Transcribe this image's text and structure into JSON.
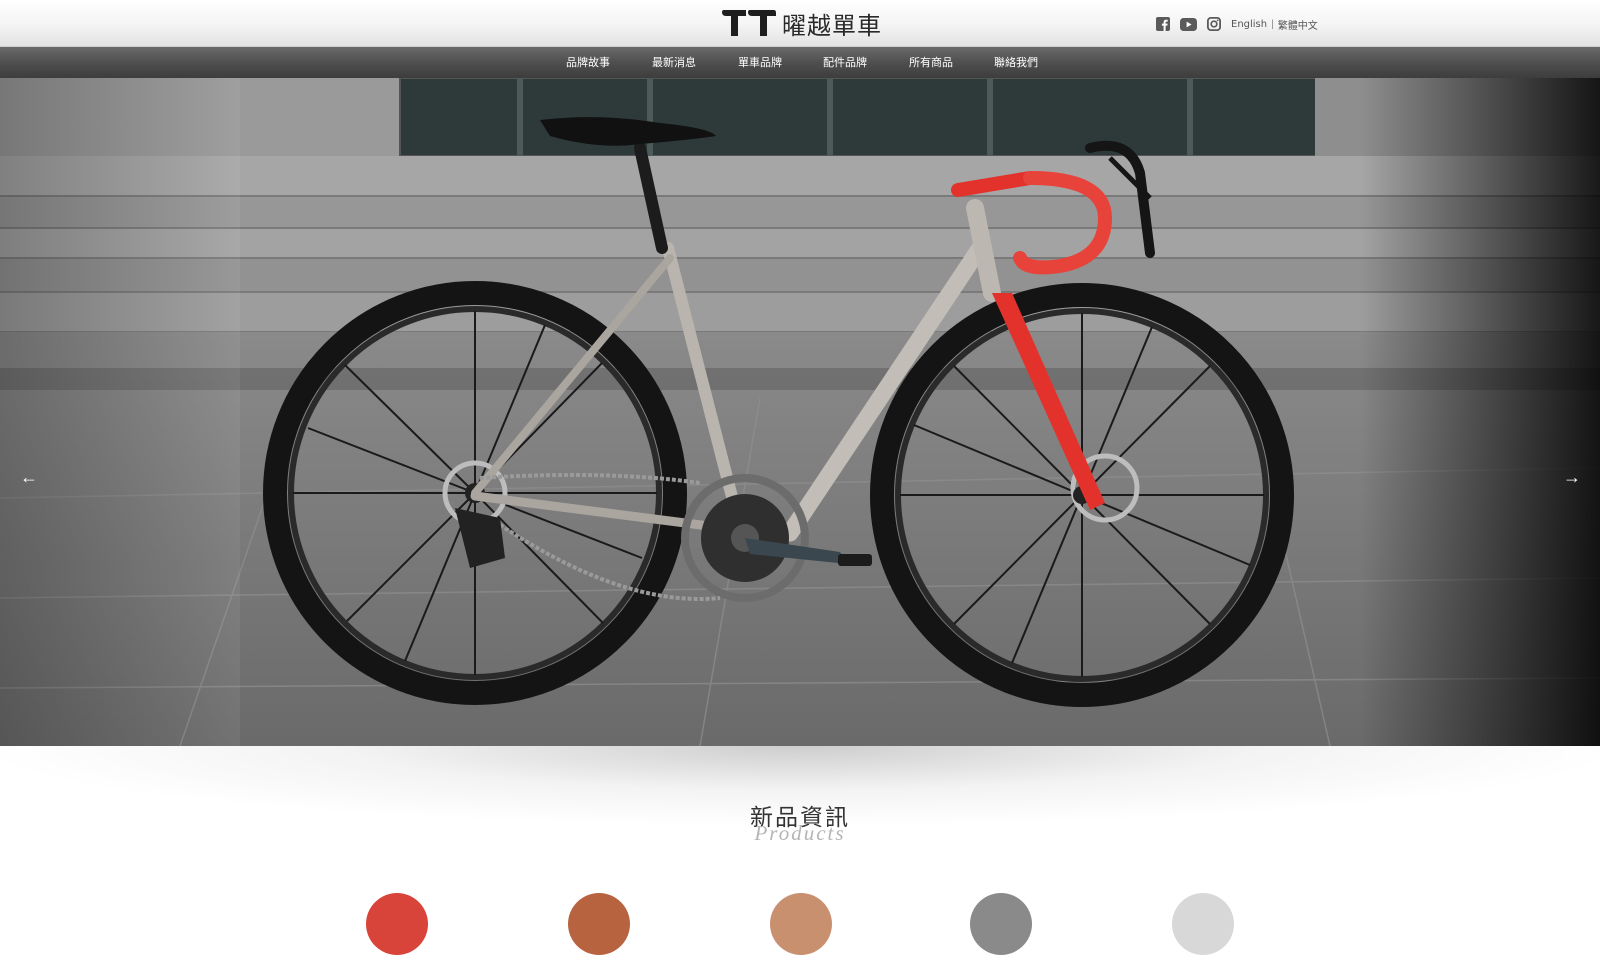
{
  "header": {
    "logo_text": "曜越單車",
    "social": [
      "facebook-icon",
      "youtube-icon",
      "instagram-icon"
    ],
    "lang_en": "English",
    "lang_sep": "|",
    "lang_zh": "繁體中文"
  },
  "nav": {
    "items": [
      {
        "label": "品牌故事"
      },
      {
        "label": "最新消息"
      },
      {
        "label": "單車品牌"
      },
      {
        "label": "配件品牌"
      },
      {
        "label": "所有商品"
      },
      {
        "label": "聯絡我們"
      }
    ]
  },
  "hero": {
    "prev_arrow": "←",
    "next_arrow": "→"
  },
  "section": {
    "title": "新品資訊",
    "subtitle": "Products"
  },
  "colors": {
    "nav_bg": "#4f4f4f",
    "fork_red": "#e3322b",
    "thumb_colors": [
      "#d9443a",
      "#b8633f",
      "#c9906f",
      "#8a8a8a",
      "#d8d8d8"
    ]
  }
}
